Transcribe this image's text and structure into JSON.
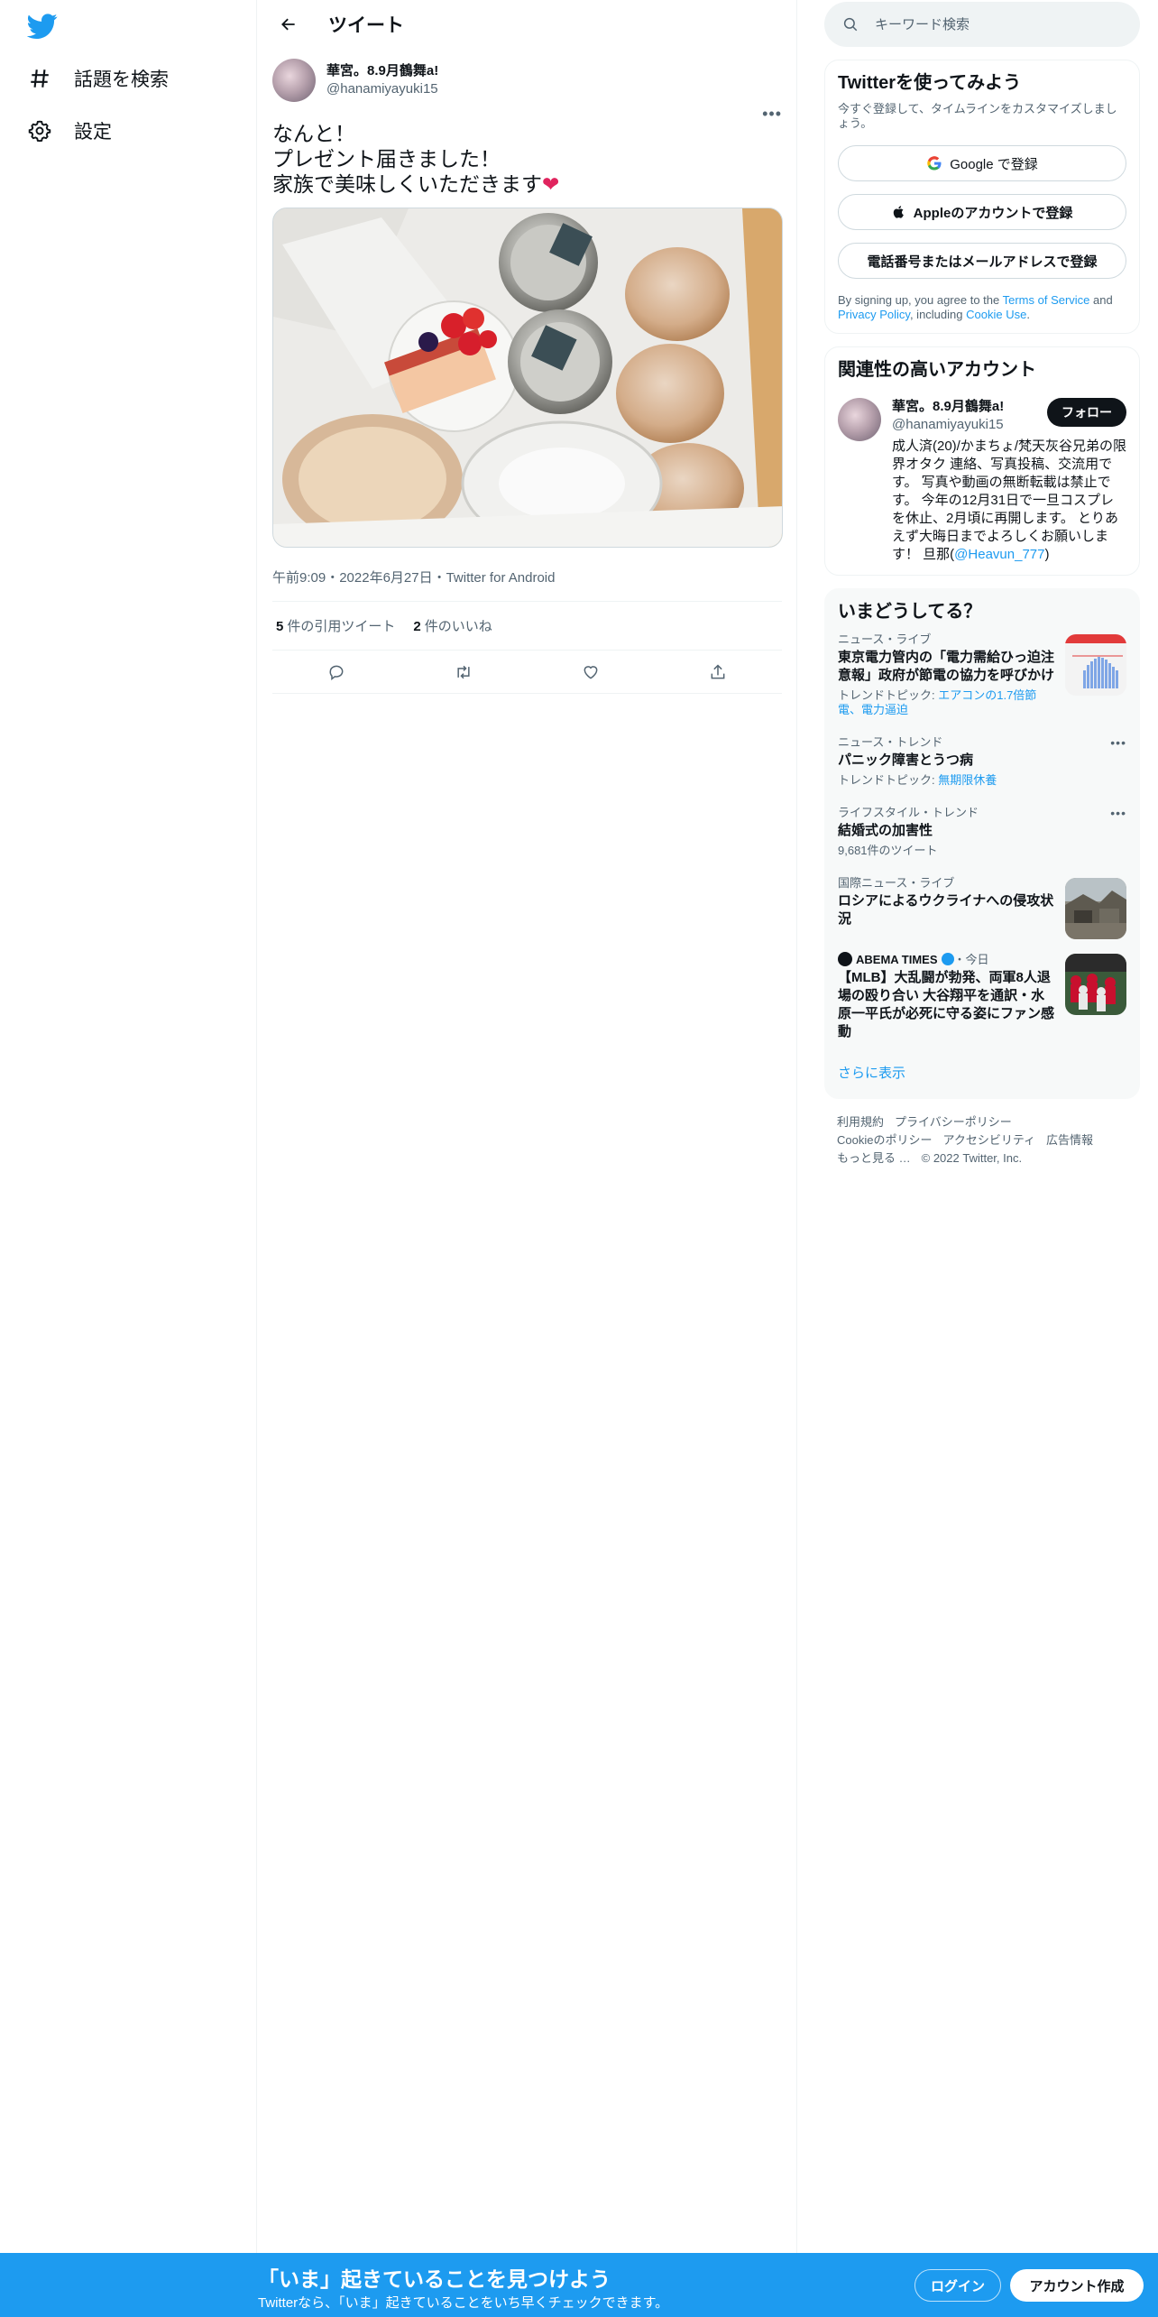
{
  "nav": {
    "explore": "話題を検索",
    "settings": "設定"
  },
  "header": {
    "title": "ツイート"
  },
  "tweet": {
    "display_name": "華宮。8.9月鶴舞a!",
    "handle": "@hanamiyayuki15",
    "text_lines": [
      "なんと！",
      "プレゼント届きました！",
      "家族で美味しくいただきます"
    ],
    "emoji": "❤",
    "meta": "午前9:09・2022年6月27日・Twitter for Android",
    "quote_count": "5",
    "quote_label": "件の引用ツイート",
    "like_count": "2",
    "like_label": "件のいいね"
  },
  "search": {
    "placeholder": "キーワード検索"
  },
  "signup_card": {
    "title": "Twitterを使ってみよう",
    "subtitle": "今すぐ登録して、タイムラインをカスタマイズしましょう。",
    "google": "Google で登録",
    "apple": "Appleのアカウントで登録",
    "phone": "電話番号またはメールアドレスで登録",
    "legal_prefix": "By signing up, you agree to the ",
    "terms": "Terms of Service",
    "and": " and ",
    "privacy": "Privacy Policy",
    "including": ", including ",
    "cookie": "Cookie Use",
    "period": "."
  },
  "related": {
    "title": "関連性の高いアカウント",
    "name": "華宮。8.9月鶴舞a!",
    "handle": "@hanamiyayuki15",
    "follow": "フォロー",
    "bio": "成人済(20)/かまちょ/梵天灰谷兄弟の限界オタク 連絡、写真投稿、交流用です。 写真や動画の無断転載は禁止です。 今年の12月31日で一旦コスプレを休止、2月頃に再開します。 とりあえず大晦日までよろしくお願いします！ 旦那(",
    "bio_link": "@Heavun_777",
    "bio_end": ")"
  },
  "trends": {
    "title": "いまどうしてる？",
    "items": [
      {
        "context": "ニュース・ライブ",
        "title": "東京電力管内の「電力需給ひっ迫注意報」政府が節電の協力を呼びかけ",
        "sub_prefix": "トレンドトピック: ",
        "sub_link": "エアコンの1.7倍節電、電力逼迫"
      },
      {
        "context": "ニュース・トレンド",
        "title": "パニック障害とうつ病",
        "sub_prefix": "トレンドトピック: ",
        "sub_link": "無期限休養"
      },
      {
        "context": "ライフスタイル・トレンド",
        "title": "結婚式の加害性",
        "sub": "9,681件のツイート"
      },
      {
        "context": "国際ニュース・ライブ",
        "title": "ロシアによるウクライナへの侵攻状況"
      },
      {
        "source": "ABEMA TIMES",
        "time": "・今日",
        "title": "【MLB】大乱闘が勃発、両軍8人退場の殴り合い 大谷翔平を通訳・水原一平氏が必死に守る姿にファン感動"
      }
    ],
    "show_more": "さらに表示"
  },
  "footer": {
    "terms": "利用規約",
    "privacy": "プライバシーポリシー",
    "cookie": "Cookieのポリシー",
    "accessibility": "アクセシビリティ",
    "ads": "広告情報",
    "more": "もっと見る …",
    "copyright": "© 2022 Twitter, Inc."
  },
  "banner": {
    "headline": "「いま」起きていることを見つけよう",
    "sub": "Twitterなら、「いま」起きていることをいち早くチェックできます。",
    "login": "ログイン",
    "signup": "アカウント作成"
  },
  "colors": {
    "accent": "#1d9bf0",
    "text": "#0f1419",
    "muted": "#536471"
  }
}
